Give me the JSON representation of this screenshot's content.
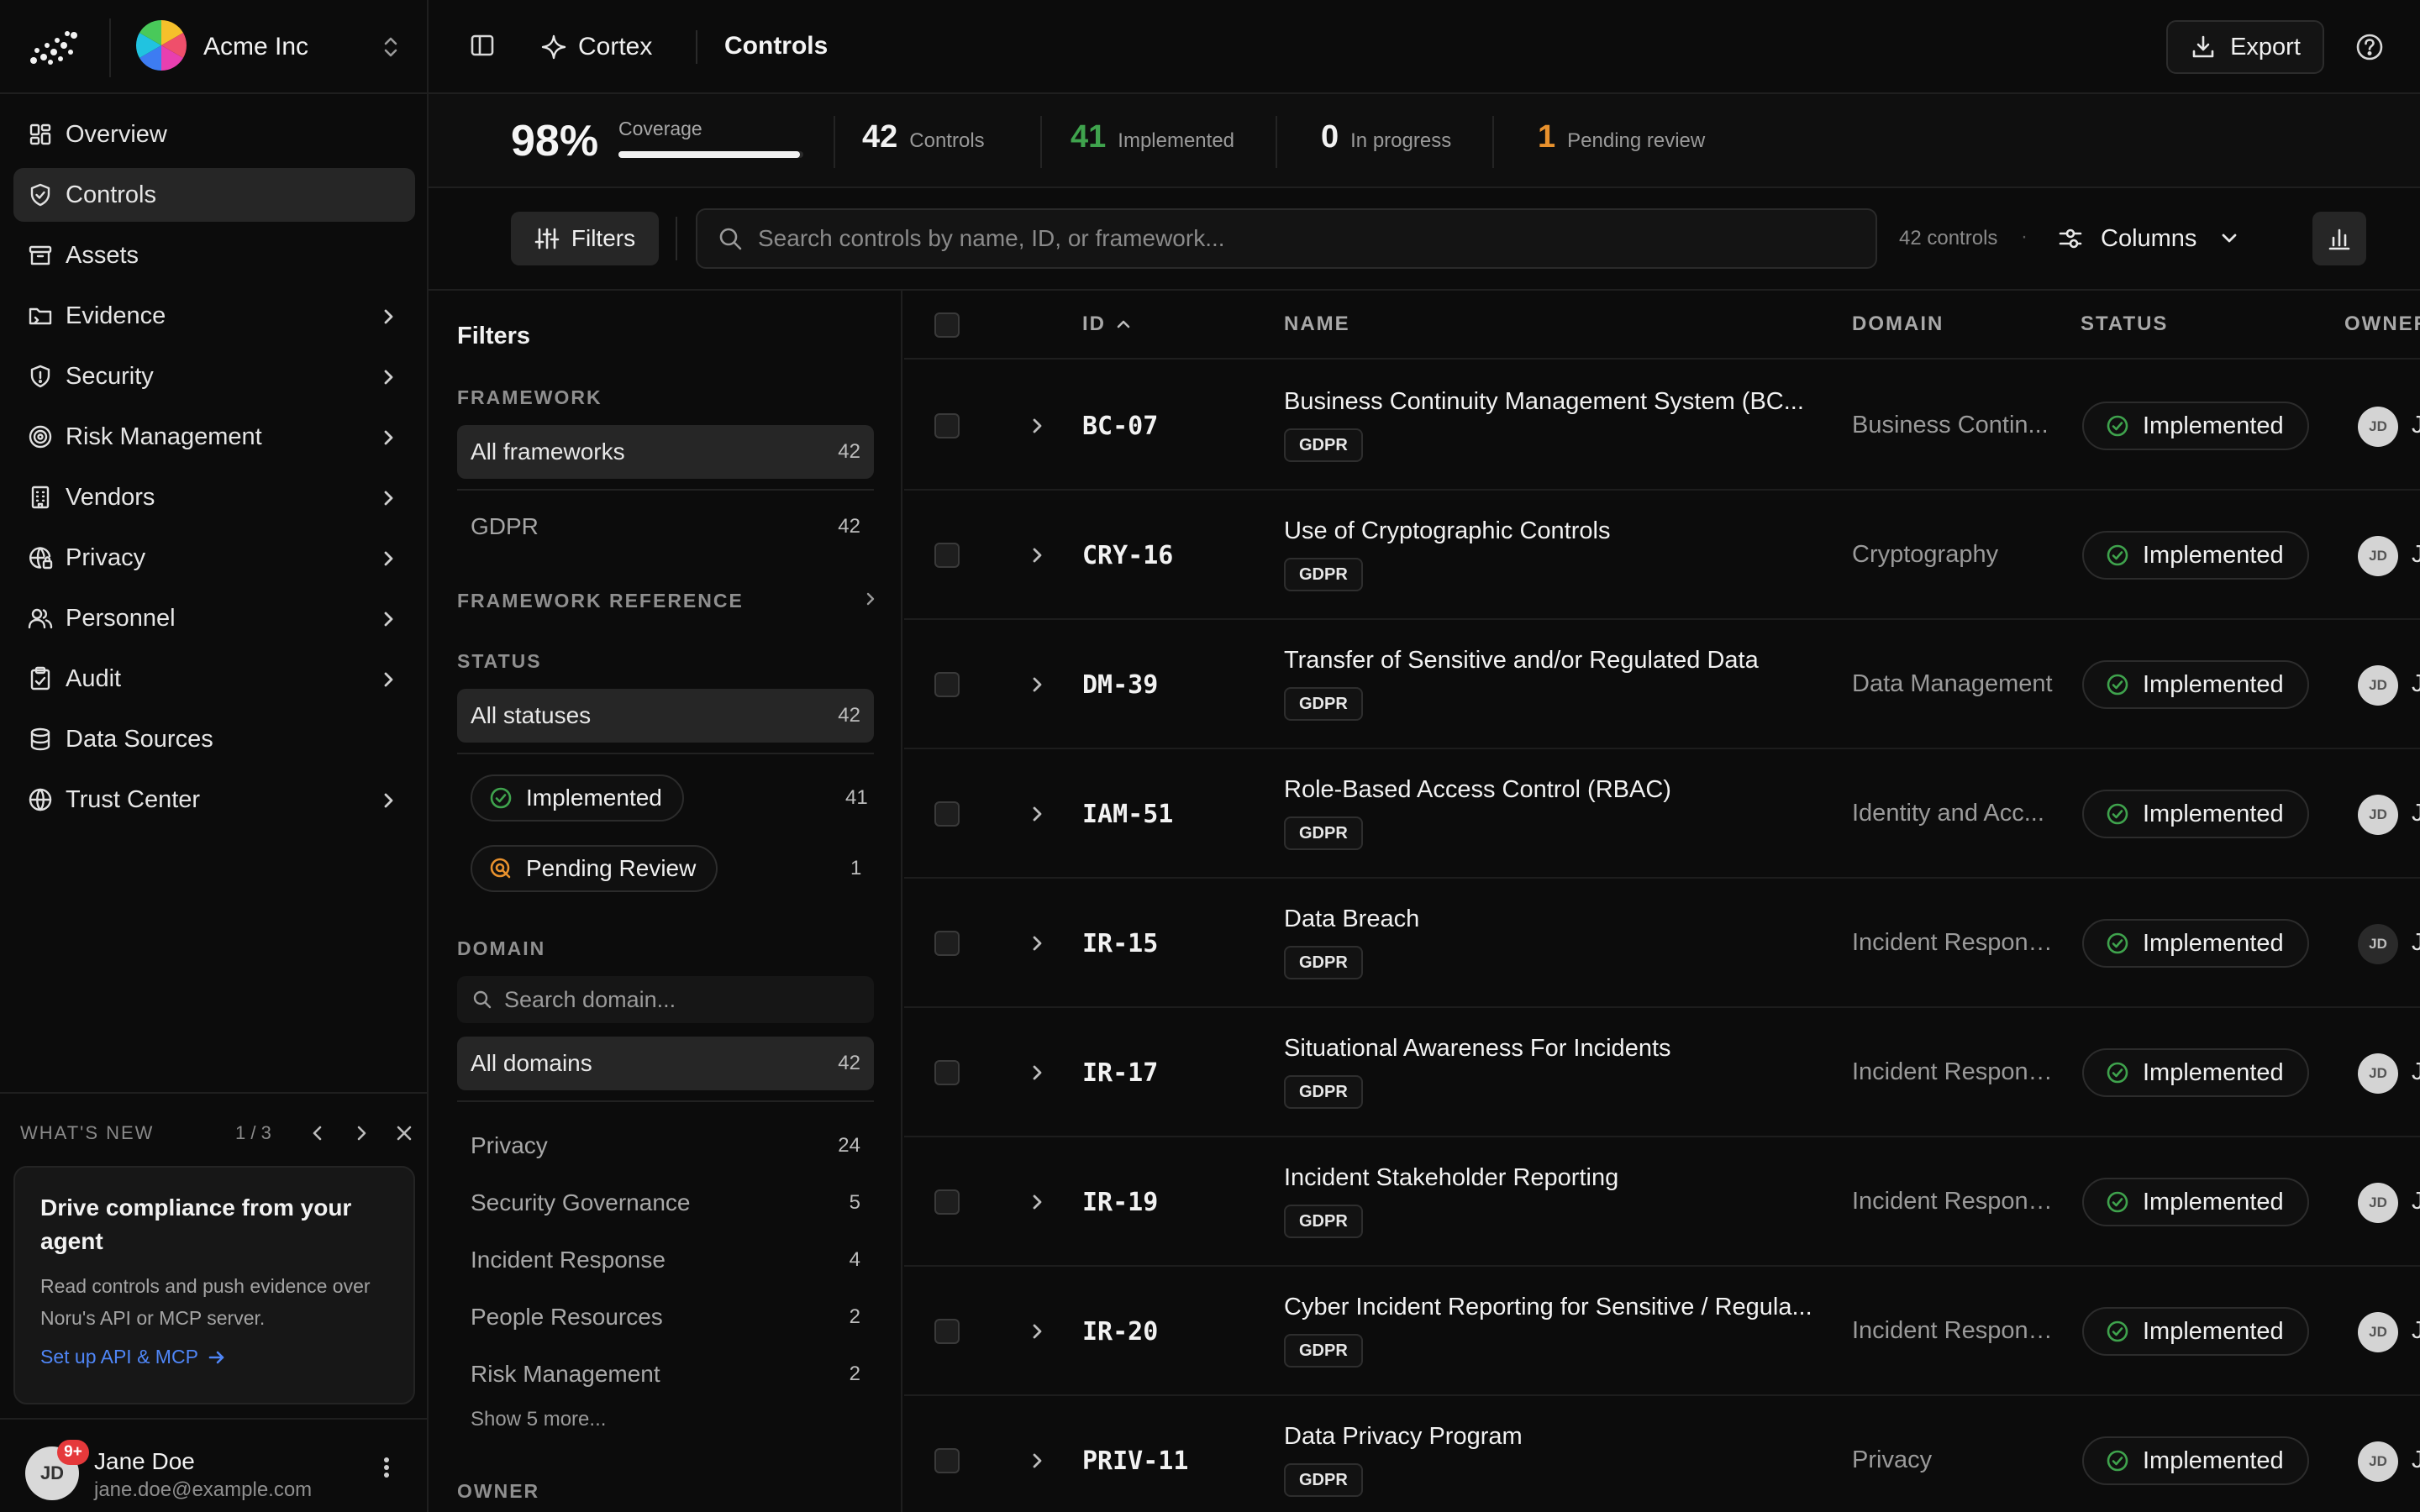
{
  "org": {
    "name": "Acme Inc"
  },
  "nav": [
    {
      "label": "Overview",
      "icon": "dashboard-icon",
      "chevron": false,
      "active": false
    },
    {
      "label": "Controls",
      "icon": "shield-check-icon",
      "chevron": false,
      "active": true
    },
    {
      "label": "Assets",
      "icon": "archive-icon",
      "chevron": false,
      "active": false
    },
    {
      "label": "Evidence",
      "icon": "folder-icon",
      "chevron": true,
      "active": false
    },
    {
      "label": "Security",
      "icon": "shield-icon",
      "chevron": true,
      "active": false
    },
    {
      "label": "Risk Management",
      "icon": "target-icon",
      "chevron": true,
      "active": false
    },
    {
      "label": "Vendors",
      "icon": "building-icon",
      "chevron": true,
      "active": false
    },
    {
      "label": "Privacy",
      "icon": "globe-lock-icon",
      "chevron": true,
      "active": false
    },
    {
      "label": "Personnel",
      "icon": "users-icon",
      "chevron": true,
      "active": false
    },
    {
      "label": "Audit",
      "icon": "clipboard-icon",
      "chevron": true,
      "active": false
    },
    {
      "label": "Data Sources",
      "icon": "database-icon",
      "chevron": false,
      "active": false
    },
    {
      "label": "Trust Center",
      "icon": "globe-icon",
      "chevron": true,
      "active": false
    }
  ],
  "whats_new": {
    "title": "WHAT'S NEW",
    "pager": "1 / 3",
    "card_title": "Drive compliance from your agent",
    "card_body": "Read controls and push evidence over Noru's API or MCP server.",
    "card_link": "Set up API & MCP"
  },
  "user": {
    "initials": "JD",
    "badge": "9+",
    "name": "Jane Doe",
    "email": "jane.doe@example.com"
  },
  "topbar": {
    "app": "Cortex",
    "page": "Controls",
    "export_label": "Export"
  },
  "stats": {
    "coverage_pct": "98%",
    "coverage_label": "Coverage",
    "coverage_fraction": 0.98,
    "items": [
      {
        "num": "42",
        "label": "Controls",
        "color": "#f2f2f2"
      },
      {
        "num": "41",
        "label": "Implemented",
        "color": "#3fa34d"
      },
      {
        "num": "0",
        "label": "In progress",
        "color": "#f2f2f2"
      },
      {
        "num": "1",
        "label": "Pending review",
        "color": "#e8912d"
      }
    ]
  },
  "toolbar": {
    "filters_label": "Filters",
    "search_placeholder": "Search controls by name, ID, or framework...",
    "count_text": "42 controls",
    "columns_label": "Columns"
  },
  "filter_panel": {
    "title": "Filters",
    "framework_heading": "FRAMEWORK",
    "framework_all": {
      "label": "All frameworks",
      "count": "42"
    },
    "framework_items": [
      {
        "label": "GDPR",
        "count": "42"
      }
    ],
    "framework_ref_heading": "FRAMEWORK REFERENCE",
    "status_heading": "STATUS",
    "status_all": {
      "label": "All statuses",
      "count": "42"
    },
    "status_items": [
      {
        "label": "Implemented",
        "count": "41",
        "icon": "check-circle-icon",
        "color": "#3fa34d"
      },
      {
        "label": "Pending Review",
        "count": "1",
        "icon": "search-review-icon",
        "color": "#e8912d"
      }
    ],
    "domain_heading": "DOMAIN",
    "domain_search_placeholder": "Search domain...",
    "domain_all": {
      "label": "All domains",
      "count": "42"
    },
    "domain_items": [
      {
        "label": "Privacy",
        "count": "24"
      },
      {
        "label": "Security Governance",
        "count": "5"
      },
      {
        "label": "Incident Response",
        "count": "4"
      },
      {
        "label": "People Resources",
        "count": "2"
      },
      {
        "label": "Risk Management",
        "count": "2"
      }
    ],
    "show_more": "Show 5 more...",
    "owner_heading": "OWNER"
  },
  "table": {
    "columns": {
      "id": "ID",
      "name": "NAME",
      "domain": "DOMAIN",
      "status": "STATUS",
      "owner": "OWNER"
    },
    "rows": [
      {
        "id": "BC-07",
        "name": "Business Continuity Management System (BC...",
        "tag": "GDPR",
        "domain": "Business Contin...",
        "status": "Implemented",
        "owner": "JD",
        "owner_initial": "J",
        "avatar_dark": false
      },
      {
        "id": "CRY-16",
        "name": "Use of Cryptographic Controls",
        "tag": "GDPR",
        "domain": "Cryptography",
        "status": "Implemented",
        "owner": "JD",
        "owner_initial": "J",
        "avatar_dark": false
      },
      {
        "id": "DM-39",
        "name": "Transfer of Sensitive and/or Regulated Data",
        "tag": "GDPR",
        "domain": "Data Management",
        "status": "Implemented",
        "owner": "JD",
        "owner_initial": "J",
        "avatar_dark": false
      },
      {
        "id": "IAM-51",
        "name": "Role-Based Access Control (RBAC)",
        "tag": "GDPR",
        "domain": "Identity and Acc...",
        "status": "Implemented",
        "owner": "JD",
        "owner_initial": "J",
        "avatar_dark": false
      },
      {
        "id": "IR-15",
        "name": "Data Breach",
        "tag": "GDPR",
        "domain": "Incident Response",
        "status": "Implemented",
        "owner": "JD",
        "owner_initial": "J",
        "avatar_dark": true
      },
      {
        "id": "IR-17",
        "name": "Situational Awareness For Incidents",
        "tag": "GDPR",
        "domain": "Incident Response",
        "status": "Implemented",
        "owner": "JD",
        "owner_initial": "J",
        "avatar_dark": false
      },
      {
        "id": "IR-19",
        "name": "Incident Stakeholder Reporting",
        "tag": "GDPR",
        "domain": "Incident Response",
        "status": "Implemented",
        "owner": "JD",
        "owner_initial": "J",
        "avatar_dark": false
      },
      {
        "id": "IR-20",
        "name": "Cyber Incident Reporting for Sensitive / Regula...",
        "tag": "GDPR",
        "domain": "Incident Response",
        "status": "Implemented",
        "owner": "JD",
        "owner_initial": "J",
        "avatar_dark": false
      },
      {
        "id": "PRIV-11",
        "name": "Data Privacy Program",
        "tag": "GDPR",
        "domain": "Privacy",
        "status": "Implemented",
        "owner": "JD",
        "owner_initial": "J",
        "avatar_dark": false
      }
    ]
  },
  "colors": {
    "accent": "#4f86f7",
    "success": "#3fa34d",
    "warning": "#e8912d",
    "danger": "#e5393b"
  }
}
